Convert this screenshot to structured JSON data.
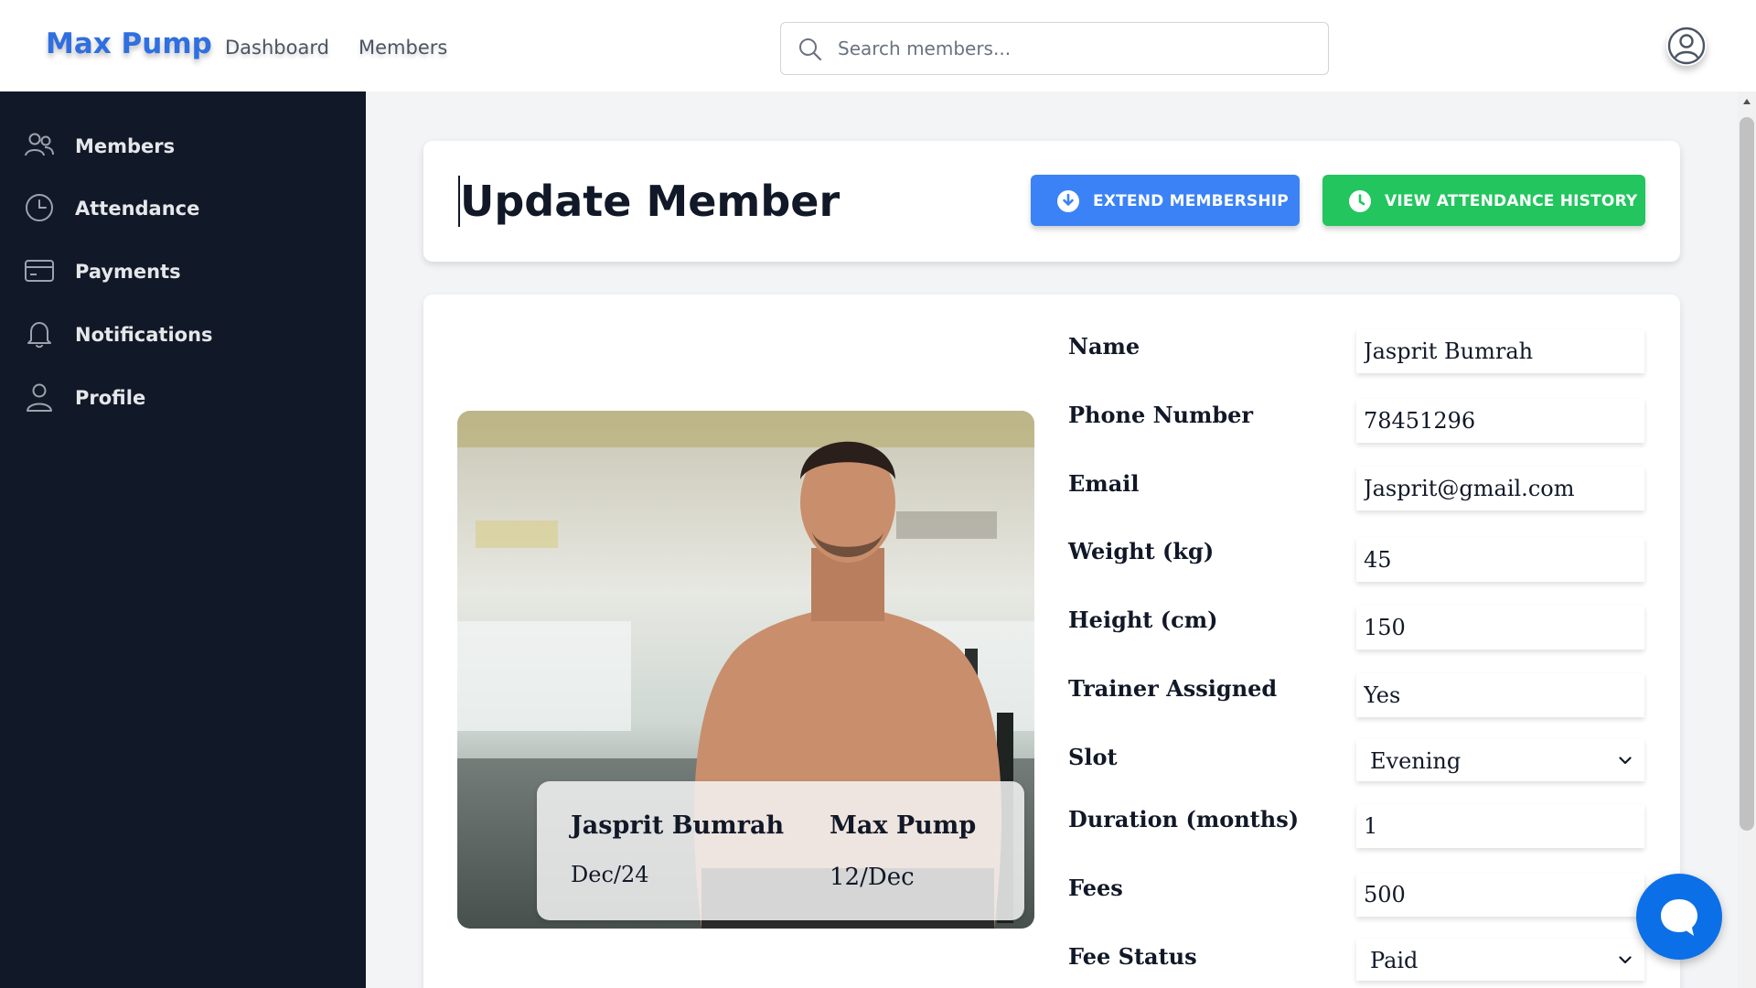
{
  "header": {
    "brand": "Max Pump",
    "nav": [
      {
        "label": "Dashboard"
      },
      {
        "label": "Members"
      }
    ],
    "search": {
      "placeholder": "Search members...",
      "value": ""
    }
  },
  "sidebar": {
    "items": [
      {
        "label": "Members",
        "icon": "users-icon"
      },
      {
        "label": "Attendance",
        "icon": "clock-icon"
      },
      {
        "label": "Payments",
        "icon": "credit-card-icon"
      },
      {
        "label": "Notifications",
        "icon": "bell-icon"
      },
      {
        "label": "Profile",
        "icon": "user-icon"
      }
    ]
  },
  "page": {
    "title": "Update Member",
    "extend_label": "EXTEND MEMBERSHIP",
    "attendance_label": "VIEW ATTENDANCE HISTORY"
  },
  "member_card": {
    "name": "Jasprit Bumrah",
    "brand": "Max Pump",
    "date": "Dec/24",
    "valid": "12/Dec"
  },
  "form": {
    "name": {
      "label": "Name",
      "value": "Jasprit Bumrah"
    },
    "phone": {
      "label": "Phone Number",
      "value": "78451296"
    },
    "email": {
      "label": "Email",
      "value": "Jasprit@gmail.com"
    },
    "weight": {
      "label": "Weight (kg)",
      "value": "45"
    },
    "height": {
      "label": "Height (cm)",
      "value": "150"
    },
    "trainer": {
      "label": "Trainer Assigned",
      "value": "Yes"
    },
    "slot": {
      "label": "Slot",
      "value": "Evening"
    },
    "duration": {
      "label": "Duration (months)",
      "value": "1"
    },
    "fees": {
      "label": "Fees",
      "value": "500"
    },
    "fee_status": {
      "label": "Fee Status",
      "value": "Paid"
    }
  },
  "colors": {
    "brand": "#2f6fe0",
    "sidebar_bg": "#111827",
    "extend_button": "#3b82f6",
    "attendance_button": "#22c55e",
    "chat_button": "#0b6fe8"
  }
}
